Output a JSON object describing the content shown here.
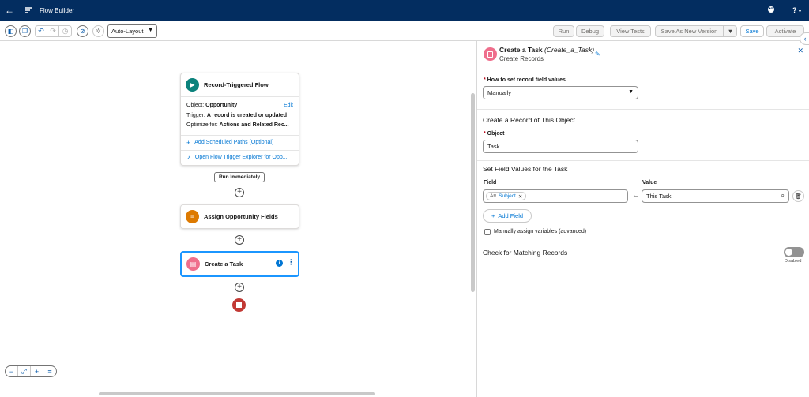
{
  "app": {
    "title": "Flow Builder"
  },
  "topbar": {
    "help": "?"
  },
  "toolbar": {
    "layout_select": "Auto-Layout",
    "run": "Run",
    "debug": "Debug",
    "view_tests": "View Tests",
    "save_as_new_version": "Save As New Version",
    "save": "Save",
    "activate": "Activate"
  },
  "canvas": {
    "start": {
      "title": "Record-Triggered Flow",
      "object_label": "Object:",
      "object_value": "Opportunity",
      "edit": "Edit",
      "trigger_label": "Trigger:",
      "trigger_value": "A record is created or updated",
      "optimize_label": "Optimize for:",
      "optimize_value": "Actions and Related Rec...",
      "add_scheduled": "Add Scheduled Paths (Optional)",
      "open_explorer": "Open Flow Trigger Explorer for Opp..."
    },
    "run_badge": "Run Immediately",
    "assign_node": {
      "title": "Assign Opportunity Fields"
    },
    "task_node": {
      "title": "Create a Task"
    }
  },
  "panel": {
    "title": "Create a Task",
    "api_name": "(Create_a_Task)",
    "subtitle": "Create Records",
    "how_label": "How to set record field values",
    "how_value": "Manually",
    "section_record": "Create a Record of This Object",
    "object_label": "Object",
    "object_value": "Task",
    "section_fields": "Set Field Values for the Task",
    "field_col": "Field",
    "value_col": "Value",
    "field_pill": "Subject",
    "value_input": "This Task",
    "add_field": "Add Field",
    "manual_assign": "Manually assign variables (advanced)",
    "section_matching": "Check for Matching Records",
    "toggle_state": "Disabled"
  },
  "colors": {
    "topbar": "#032d60",
    "start_icon": "#0b827c",
    "assign_icon": "#dd7a01",
    "task_icon": "#ef6e8c",
    "end": "#c23934",
    "link": "#0176d3"
  }
}
